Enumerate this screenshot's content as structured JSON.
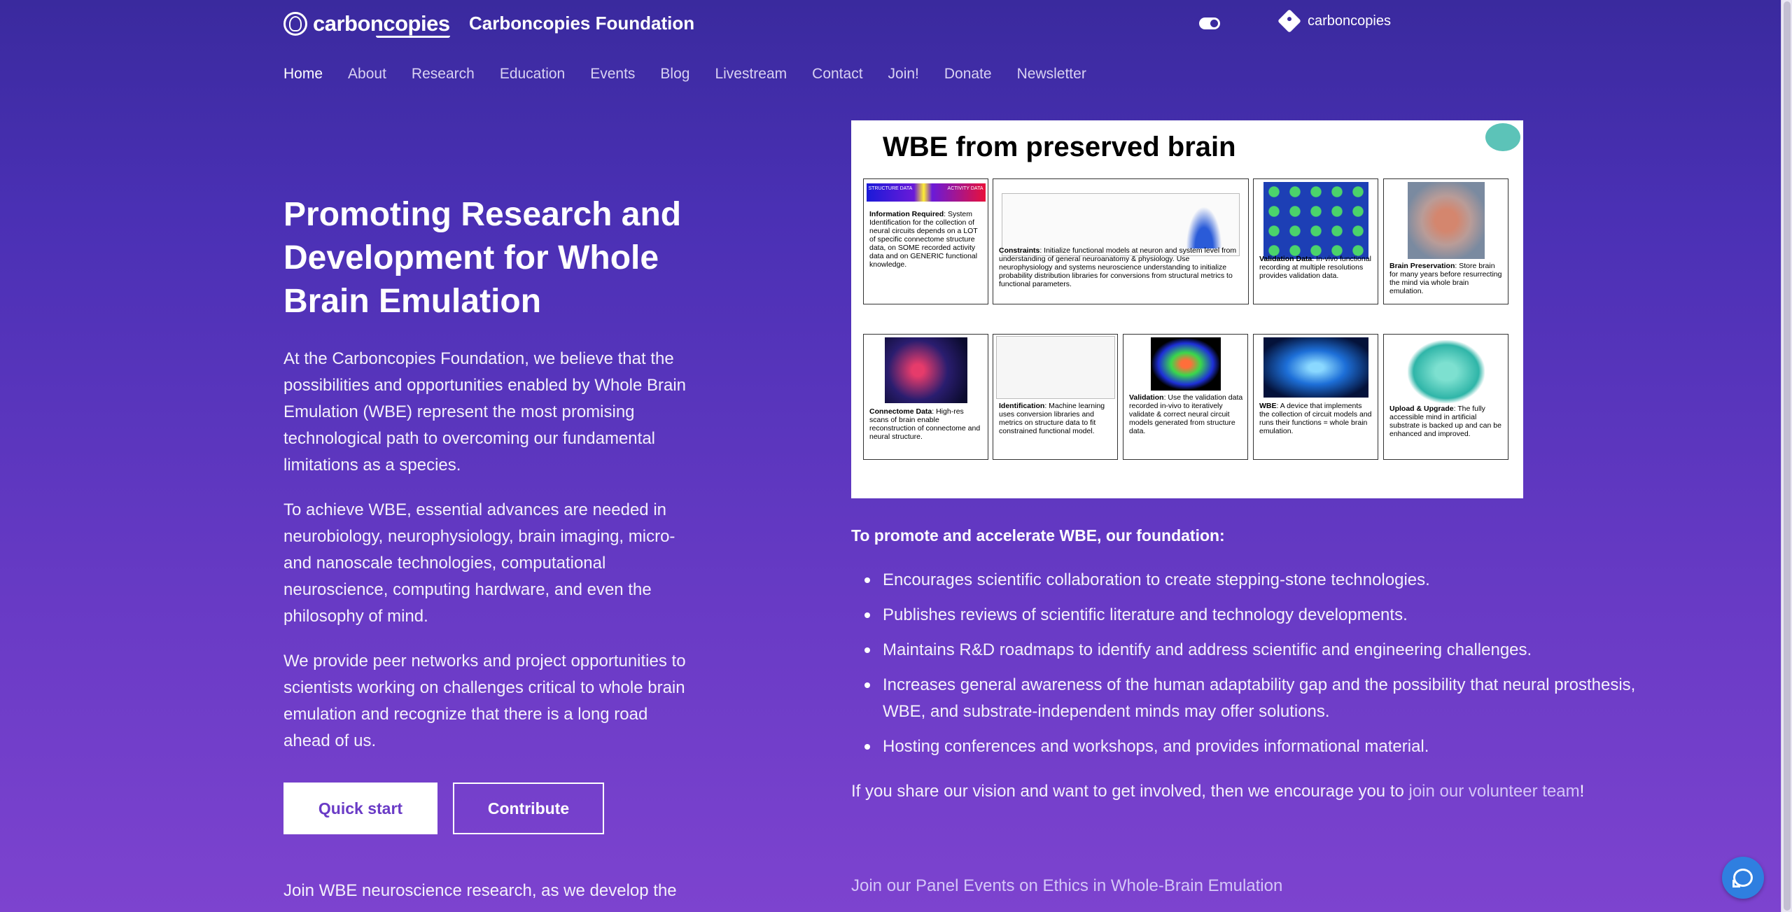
{
  "header": {
    "logo_text": "carboncopies",
    "site_title": "Carboncopies Foundation",
    "repo_label": "carboncopies"
  },
  "nav": {
    "items": [
      {
        "label": "Home",
        "active": true
      },
      {
        "label": "About"
      },
      {
        "label": "Research"
      },
      {
        "label": "Education"
      },
      {
        "label": "Events"
      },
      {
        "label": "Blog"
      },
      {
        "label": "Livestream"
      },
      {
        "label": "Contact"
      },
      {
        "label": "Join!"
      },
      {
        "label": "Donate"
      },
      {
        "label": "Newsletter"
      }
    ]
  },
  "hero": {
    "title": "Promoting Research and Development for Whole Brain Emulation",
    "p1": "At the Carboncopies Foundation, we believe that the possibilities and opportunities enabled by Whole Brain Emulation (WBE) represent the most promising technological path to overcoming our fundamental limitations as a species.",
    "p2": "To achieve WBE, essential advances are needed in neurobiology, neurophysiology, brain imaging, micro- and nanoscale technologies, computational neuroscience, computing hardware, and even the philosophy of mind.",
    "p3": "We provide peer networks and project opportunities to scientists working on challenges critical to whole brain emulation and recognize that there is a long road ahead of us.",
    "quick_start": "Quick start",
    "contribute": "Contribute",
    "p4": "Join WBE neuroscience research, as we develop the"
  },
  "figure": {
    "title": "WBE from preserved brain",
    "spectrum_left": "STRUCTURE DATA",
    "spectrum_right": "ACTIVITY DATA",
    "panels": [
      {
        "heading": "Information Required",
        "text": ": System Identification for the collection of neural circuits depends on a LOT of specific connectome structure data, on SOME recorded activity data and on GENERIC functional knowledge."
      },
      {
        "heading": "Constraints",
        "text": ": Initialize functional models at neuron and system level from understanding of general neuroanatomy & physiology. Use neurophysiology and systems neuroscience understanding to initialize probability distribution libraries for conversions from structural metrics to functional parameters."
      },
      {
        "heading": "Validation Data",
        "text": ": In-vivo functional recording at multiple resolutions provides validation data."
      },
      {
        "heading": "Brain Preservation",
        "text": ": Store brain for many years before resurrecting the mind via whole brain emulation."
      },
      {
        "heading": "Connectome Data",
        "text": ": High-res scans of brain enable reconstruction of connectome and neural structure."
      },
      {
        "heading": "Identification",
        "text": ": Machine learning uses conversion libraries and metrics on structure data to fit constrained functional model."
      },
      {
        "heading": "Validation",
        "text": ": Use the validation data recorded in-vivo to iteratively validate & correct neural circuit models generated from structure data."
      },
      {
        "heading": "WBE",
        "text": ": A device that implements the collection of circuit models and runs their functions = whole brain emulation."
      },
      {
        "heading": "Upload & Upgrade",
        "text": ": The fully accessible mind in artificial substrate is backed up and can be enhanced and improved."
      }
    ]
  },
  "promote": {
    "heading": "To promote and accelerate WBE, our foundation:",
    "items": [
      "Encourages scientific collaboration to create stepping-stone technologies.",
      "Publishes reviews of scientific literature and technology developments.",
      "Maintains R&D roadmaps to identify and address scientific and engineering challenges.",
      "Increases general awareness of the human adaptability gap and the possibility that neural prosthesis, WBE, and substrate-independent minds may offer solutions.",
      "Hosting conferences and workshops, and provides informational material."
    ],
    "invite_prefix": "If you share our vision and want to get involved, then we encourage you to ",
    "invite_link": "join our volunteer team",
    "invite_suffix": "!",
    "panel_events": "Join our Panel Events on Ethics in Whole-Brain Emulation"
  },
  "colors": {
    "background_top": "#3a2a9e",
    "background_bottom": "#7d43cf",
    "chat_button": "#2f7fe0"
  },
  "icons": {
    "logo": "brain-logo-icon",
    "theme": "toggle-icon",
    "repo": "git-icon",
    "chat": "chat-bubble-icon"
  }
}
